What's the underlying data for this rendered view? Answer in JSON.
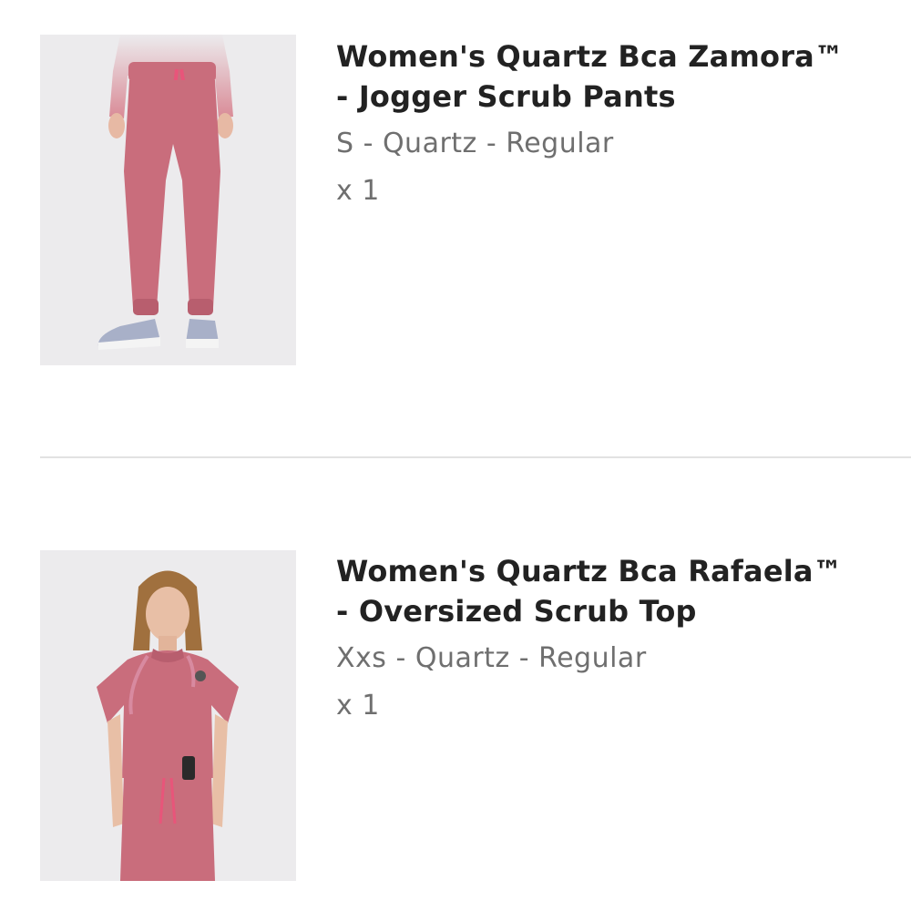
{
  "cart": {
    "items": [
      {
        "title_line1": "Women's Quartz Bca Zamora™",
        "title_line2": "- Jogger Scrub Pants",
        "variant": "S - Quartz - Regular",
        "quantity": "x 1",
        "image_icon": "product-photo-jogger-pants"
      },
      {
        "title_line1": "Women's Quartz Bca Rafaela™",
        "title_line2": "- Oversized Scrub Top",
        "variant": "Xxs - Quartz - Regular",
        "quantity": "x 1",
        "image_icon": "product-photo-scrub-top"
      }
    ]
  },
  "colors": {
    "product_quartz": "#c96d7c",
    "title_text": "#222222",
    "meta_text": "#6f6f6f",
    "divider": "#e2e2e2"
  }
}
